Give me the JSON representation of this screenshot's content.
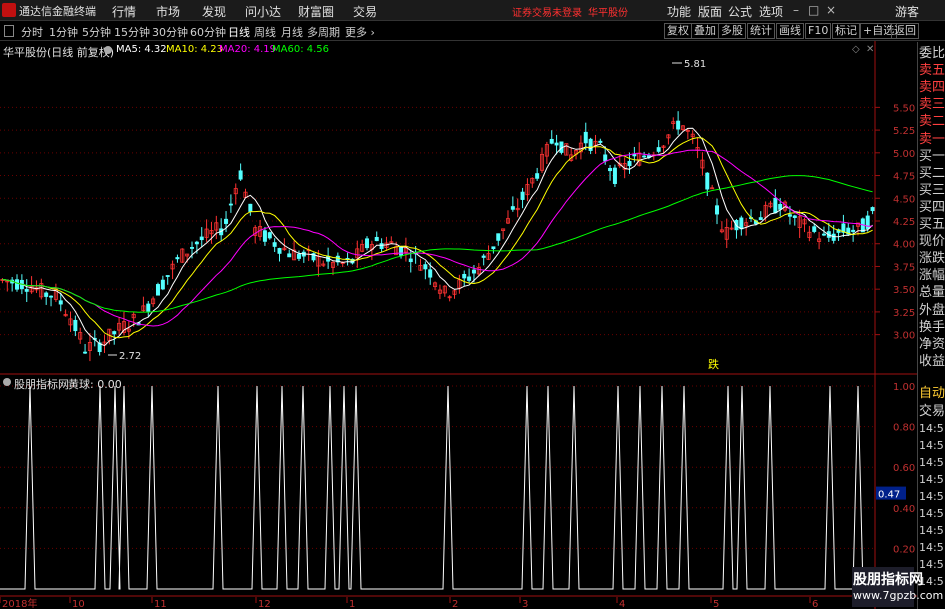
{
  "app": {
    "title": "通达信金融终端",
    "login_status": "证券交易未登录",
    "stock": "华平股份"
  },
  "menu": [
    "行情",
    "市场",
    "发现",
    "问小达",
    "财富圈",
    "交易"
  ],
  "right_menu": [
    "功能",
    "版面",
    "公式",
    "选项"
  ],
  "user": "游客",
  "window_buttons": [
    "–",
    "□",
    "×"
  ],
  "timeframes": [
    "分时",
    "1分钟",
    "5分钟",
    "15分钟",
    "30分钟",
    "60分钟",
    "日线",
    "周线",
    "月线",
    "多周期",
    "更多 ›"
  ],
  "active_timeframe": "日线",
  "tool_buttons": [
    "复权",
    "叠加",
    "多股",
    "统计",
    "画线",
    "F10",
    "标记",
    "+自选",
    "返回"
  ],
  "chart": {
    "title": "华平股份(日线 前复权)",
    "ma": [
      {
        "label": "MA5: 4.32",
        "color": "#ffffff"
      },
      {
        "label": "MA10: 4.23",
        "color": "#ffff00"
      },
      {
        "label": "MA20: 4.19",
        "color": "#ff00ff"
      },
      {
        "label": "MA60: 4.56",
        "color": "#00ff00"
      }
    ],
    "price_axis": [
      "5.50",
      "5.25",
      "5.00",
      "4.75",
      "4.50",
      "4.25",
      "4.00",
      "3.75",
      "3.50",
      "3.25",
      "3.00"
    ],
    "high_label": "5.81",
    "low_label": "2.72",
    "event_marker": "跌",
    "up_color": "#ff3232",
    "down_color": "#54ffff"
  },
  "indicator": {
    "title": "股朋指标网",
    "value": "黄球: 0.00",
    "axis": [
      "1.00",
      "0.80",
      "0.60",
      "0.40",
      "0.20"
    ],
    "current_value": "0.47",
    "line_color": "#ffffff"
  },
  "date_axis": [
    "2018年",
    "10",
    "11",
    "12",
    "1",
    "2",
    "3",
    "4",
    "5",
    "6"
  ],
  "right_panel": {
    "orderbook": [
      "委比",
      "卖五",
      "卖四",
      "卖三",
      "卖二",
      "卖一",
      "买一",
      "买二",
      "买三",
      "买四",
      "买五",
      "现价",
      "涨跌",
      "涨幅",
      "总量",
      "外盘",
      "换手",
      "净资",
      "收益"
    ],
    "auto_label": "自动",
    "trade_label": "交易",
    "times": [
      "14:5",
      "14:5",
      "14:5",
      "14:5",
      "14:5",
      "14:5",
      "14:5",
      "14:5",
      "14:5",
      "14:5"
    ]
  },
  "watermark": {
    "line1": "股朋指标网",
    "line2": "www.7gpzb.com"
  }
}
